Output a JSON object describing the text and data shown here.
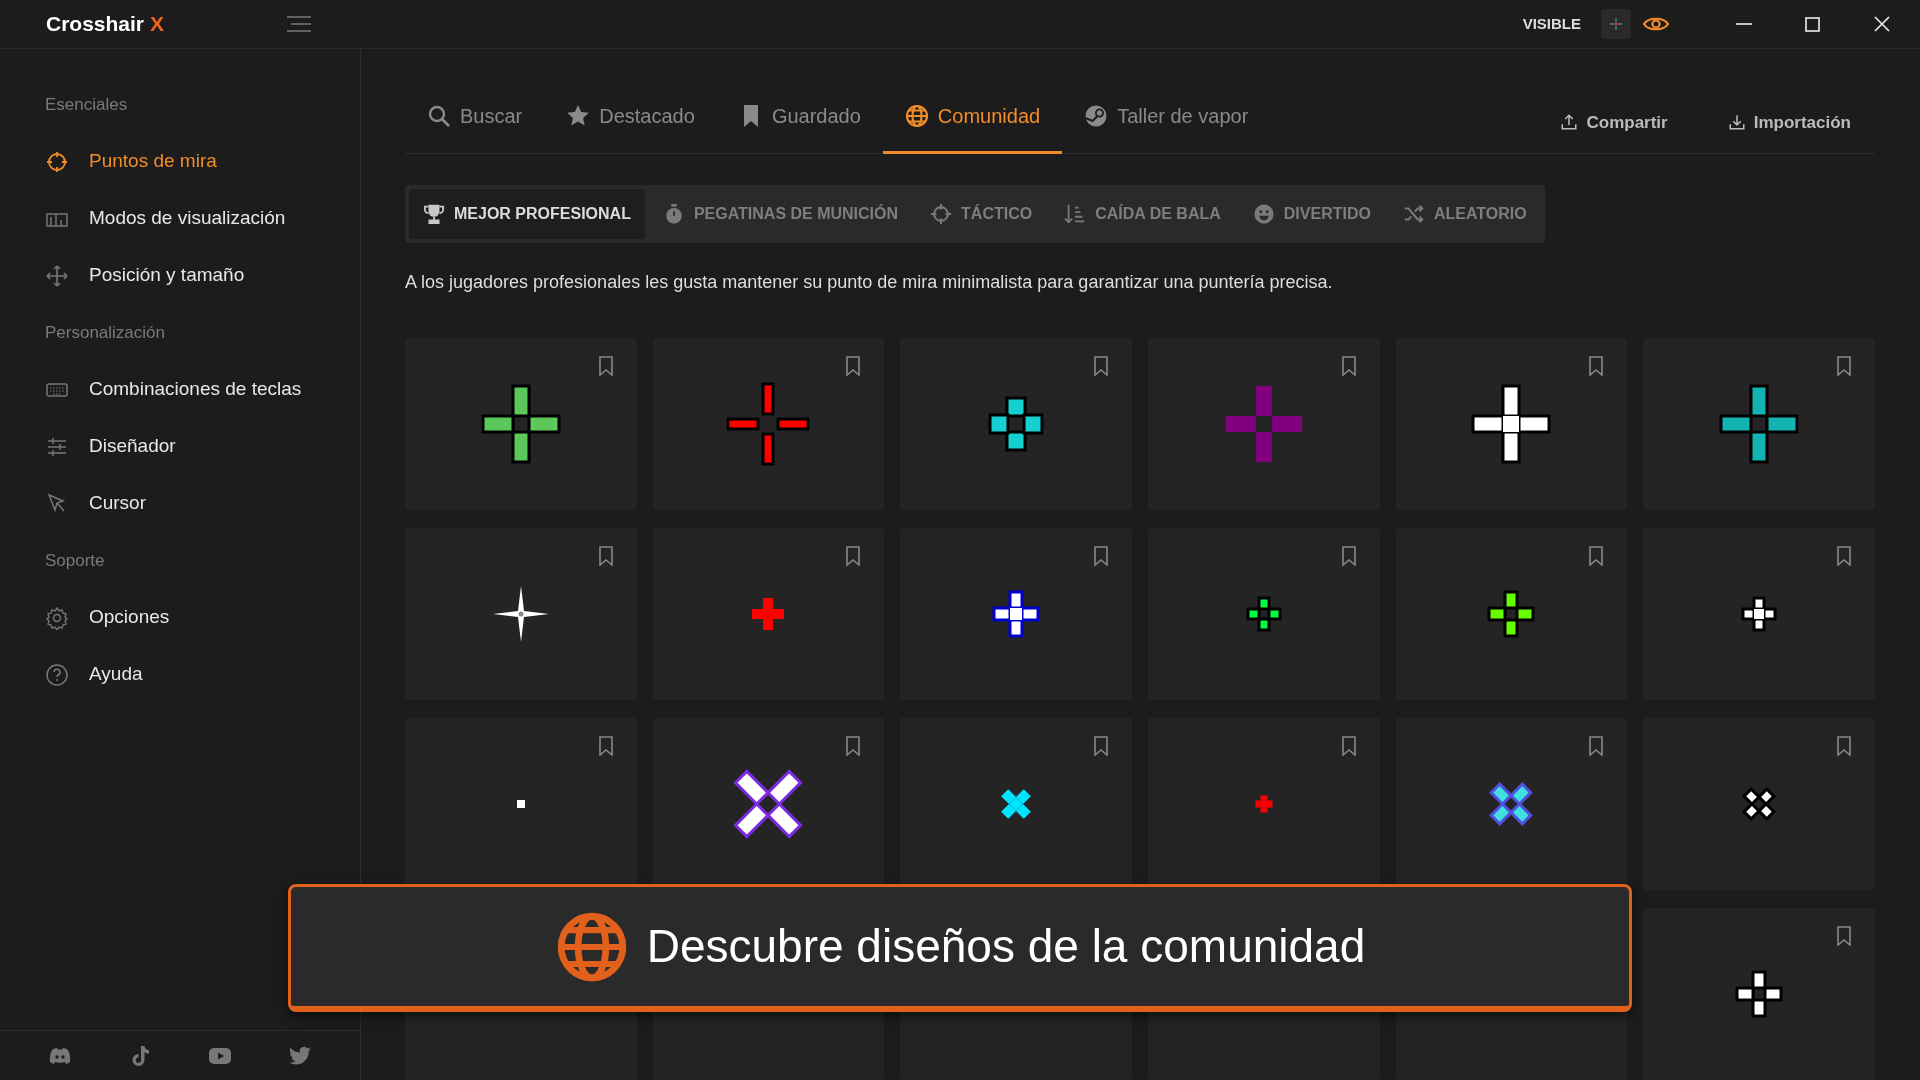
{
  "app": {
    "name": "Crosshair",
    "accent": "X"
  },
  "titlebar": {
    "visibility_label": "VISIBLE"
  },
  "sidebar": {
    "sections": [
      {
        "title": "Esenciales",
        "items": [
          {
            "label": "Puntos de mira",
            "selected": true
          },
          {
            "label": "Modos de visualización",
            "selected": false
          },
          {
            "label": "Posición y tamaño",
            "selected": false
          }
        ]
      },
      {
        "title": "Personalización",
        "items": [
          {
            "label": "Combinaciones de teclas",
            "selected": false
          },
          {
            "label": "Diseñador",
            "selected": false
          },
          {
            "label": "Cursor",
            "selected": false
          }
        ]
      },
      {
        "title": "Soporte",
        "items": [
          {
            "label": "Opciones",
            "selected": false
          },
          {
            "label": "Ayuda",
            "selected": false
          }
        ]
      }
    ]
  },
  "tabs": [
    {
      "label": "Buscar",
      "selected": false
    },
    {
      "label": "Destacado",
      "selected": false
    },
    {
      "label": "Guardado",
      "selected": false
    },
    {
      "label": "Comunidad",
      "selected": true
    },
    {
      "label": "Taller de vapor",
      "selected": false
    }
  ],
  "actions": [
    {
      "label": "Compartir"
    },
    {
      "label": "Importación"
    }
  ],
  "categories": [
    {
      "label": "MEJOR PROFESIONAL",
      "selected": true
    },
    {
      "label": "PEGATINAS DE MUNICIÓN",
      "selected": false
    },
    {
      "label": "TÁCTICO",
      "selected": false
    },
    {
      "label": "CAÍDA DE BALA",
      "selected": false
    },
    {
      "label": "DIVERTIDO",
      "selected": false
    },
    {
      "label": "ALEATORIO",
      "selected": false
    }
  ],
  "description": "A los jugadores profesionales les gusta mantener su punto de mira minimalista para garantizar una puntería precisa.",
  "crosshairs": [
    {
      "kind": "plus",
      "color": "#5cc85c",
      "saved": false
    },
    {
      "kind": "plus",
      "color": "#ff0000",
      "saved": false
    },
    {
      "kind": "dots",
      "color": "#14d0d0",
      "saved": false
    },
    {
      "kind": "plus",
      "color": "#800080",
      "saved": false
    },
    {
      "kind": "plus",
      "color": "#ffffff",
      "saved": false
    },
    {
      "kind": "plus",
      "color": "#14b4b4",
      "saved": false
    },
    {
      "kind": "star",
      "color": "#ffffff",
      "saved": false
    },
    {
      "kind": "plus",
      "color": "#ff0000",
      "saved": false
    },
    {
      "kind": "plus",
      "color": "#ffffff",
      "saved": false
    },
    {
      "kind": "plus",
      "color": "#00ff40",
      "saved": false
    },
    {
      "kind": "plus",
      "color": "#66ff00",
      "saved": false
    },
    {
      "kind": "plus",
      "color": "#ffffff",
      "saved": false
    },
    {
      "kind": "dot",
      "color": "#ffffff",
      "saved": false
    },
    {
      "kind": "x",
      "color": "#ffffff",
      "saved": false
    },
    {
      "kind": "x",
      "color": "#00e5ff",
      "saved": false
    },
    {
      "kind": "plus",
      "color": "#ff0000",
      "saved": false
    },
    {
      "kind": "x",
      "color": "#40e0e0",
      "saved": false
    },
    {
      "kind": "x",
      "color": "#ffffff",
      "saved": false
    },
    {
      "kind": "none"
    },
    {
      "kind": "none"
    },
    {
      "kind": "none"
    },
    {
      "kind": "none"
    },
    {
      "kind": "none"
    },
    {
      "kind": "plus",
      "color": "#ffffff",
      "saved": false
    }
  ],
  "banner": {
    "text": "Descubre diseños de la comunidad"
  }
}
